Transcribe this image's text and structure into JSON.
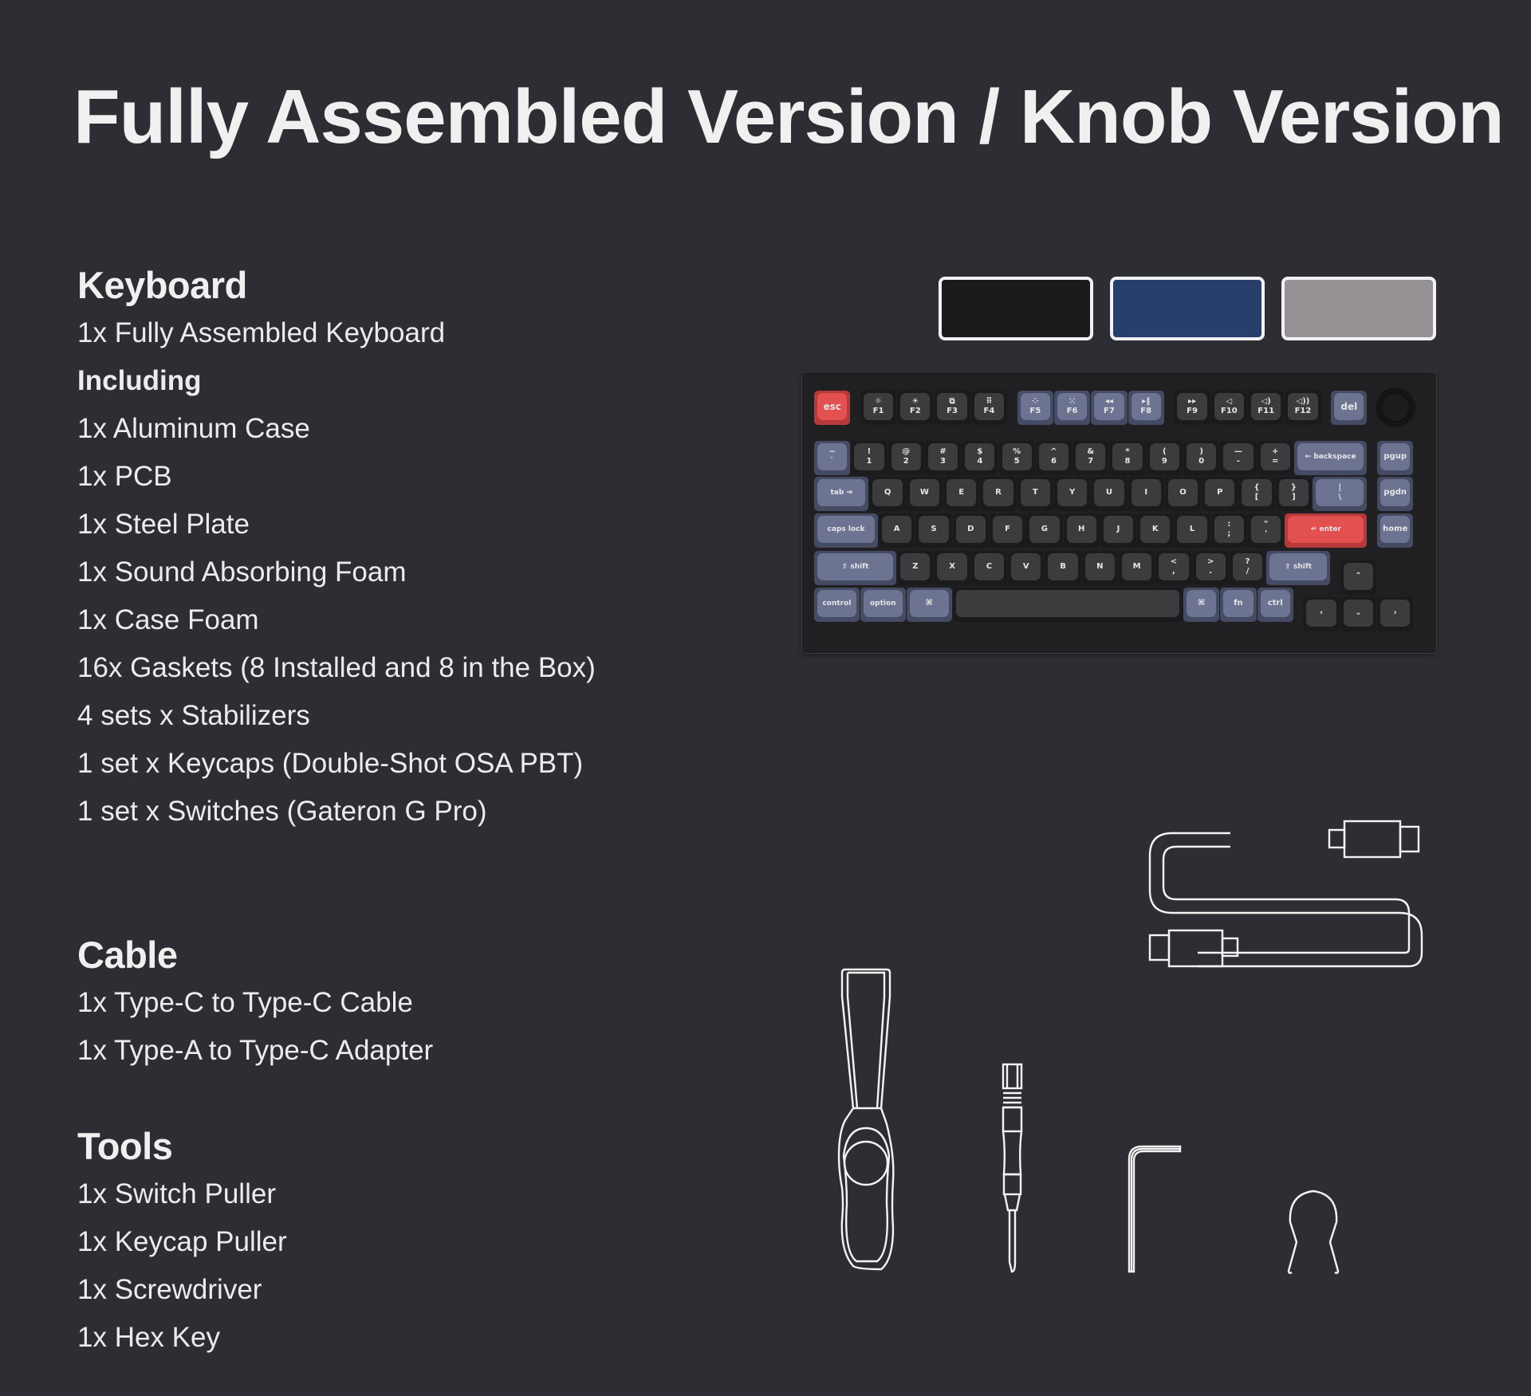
{
  "title": "Fully Assembled Version / Knob Version",
  "sections": {
    "keyboard": {
      "heading": "Keyboard",
      "items": [
        {
          "text": "1x Fully Assembled Keyboard",
          "bold": false
        },
        {
          "text": "Including",
          "bold": true
        },
        {
          "text": "1x Aluminum Case",
          "bold": false
        },
        {
          "text": "1x PCB",
          "bold": false
        },
        {
          "text": "1x Steel Plate",
          "bold": false
        },
        {
          "text": "1x Sound Absorbing Foam",
          "bold": false
        },
        {
          "text": "1x Case Foam",
          "bold": false
        },
        {
          "text": "16x Gaskets (8 Installed and 8 in the Box)",
          "bold": false
        },
        {
          "text": "4 sets x Stabilizers",
          "bold": false
        },
        {
          "text": "1 set x Keycaps (Double-Shot OSA PBT)",
          "bold": false
        },
        {
          "text": "1 set x Switches (Gateron G Pro)",
          "bold": false
        }
      ]
    },
    "cable": {
      "heading": "Cable",
      "items": [
        {
          "text": "1x Type-C to Type-C Cable",
          "bold": false
        },
        {
          "text": "1x Type-A to Type-C Adapter",
          "bold": false
        }
      ]
    },
    "tools": {
      "heading": "Tools",
      "items": [
        {
          "text": "1x Switch Puller",
          "bold": false
        },
        {
          "text": "1x Keycap Puller",
          "bold": false
        },
        {
          "text": "1x Screwdriver",
          "bold": false
        },
        {
          "text": "1x Hex Key",
          "bold": false
        }
      ]
    }
  },
  "color_options": [
    {
      "name": "black",
      "color": "#1b1b1b"
    },
    {
      "name": "navy-blue",
      "color": "#283e6c"
    },
    {
      "name": "silver-grey",
      "color": "#959194"
    }
  ],
  "keyboard": {
    "rows": [
      [
        {
          "top": "",
          "label": "esc",
          "style": "red",
          "w": 1
        },
        {
          "gap": 0.25
        },
        {
          "top": "☼",
          "label": "F1",
          "style": "dark",
          "w": 1
        },
        {
          "top": "☀",
          "label": "F2",
          "style": "dark",
          "w": 1
        },
        {
          "top": "⧉",
          "label": "F3",
          "style": "dark",
          "w": 1
        },
        {
          "top": "⠿",
          "label": "F4",
          "style": "dark",
          "w": 1
        },
        {
          "gap": 0.25
        },
        {
          "top": "⁘",
          "label": "F5",
          "style": "blue",
          "w": 1
        },
        {
          "top": "⁙",
          "label": "F6",
          "style": "blue",
          "w": 1
        },
        {
          "top": "◂◂",
          "label": "F7",
          "style": "blue",
          "w": 1
        },
        {
          "top": "▸‖",
          "label": "F8",
          "style": "blue",
          "w": 1
        },
        {
          "gap": 0.25
        },
        {
          "top": "▸▸",
          "label": "F9",
          "style": "dark",
          "w": 1
        },
        {
          "top": "◁",
          "label": "F10",
          "style": "dark",
          "w": 1
        },
        {
          "top": "◁)",
          "label": "F11",
          "style": "dark",
          "w": 1
        },
        {
          "top": "◁))",
          "label": "F12",
          "style": "dark",
          "w": 1
        },
        {
          "gap": 0.25
        },
        {
          "top": "",
          "label": "del",
          "style": "blue",
          "w": 1
        },
        {
          "gap": 0.25
        },
        {
          "knob": true,
          "w": 1
        }
      ],
      [
        {
          "top": "~",
          "label": "`",
          "style": "blue",
          "w": 1
        },
        {
          "top": "!",
          "label": "1",
          "style": "dark",
          "w": 1
        },
        {
          "top": "@",
          "label": "2",
          "style": "dark",
          "w": 1
        },
        {
          "top": "#",
          "label": "3",
          "style": "dark",
          "w": 1
        },
        {
          "top": "$",
          "label": "4",
          "style": "dark",
          "w": 1
        },
        {
          "top": "%",
          "label": "5",
          "style": "dark",
          "w": 1
        },
        {
          "top": "^",
          "label": "6",
          "style": "dark",
          "w": 1
        },
        {
          "top": "&",
          "label": "7",
          "style": "dark",
          "w": 1
        },
        {
          "top": "*",
          "label": "8",
          "style": "dark",
          "w": 1
        },
        {
          "top": "(",
          "label": "9",
          "style": "dark",
          "w": 1
        },
        {
          "top": ")",
          "label": "0",
          "style": "dark",
          "w": 1
        },
        {
          "top": "—",
          "label": "-",
          "style": "dark",
          "w": 1
        },
        {
          "top": "+",
          "label": "=",
          "style": "dark",
          "w": 1
        },
        {
          "top": "",
          "label": "← backspace",
          "style": "blue",
          "w": 2
        },
        {
          "gap": 0.25
        },
        {
          "top": "",
          "label": "pgup",
          "style": "blue",
          "w": 1
        }
      ],
      [
        {
          "top": "",
          "label": "tab ⇥",
          "style": "blue",
          "w": 1.5
        },
        {
          "top": "",
          "label": "Q",
          "style": "dark",
          "w": 1
        },
        {
          "top": "",
          "label": "W",
          "style": "dark",
          "w": 1
        },
        {
          "top": "",
          "label": "E",
          "style": "dark",
          "w": 1
        },
        {
          "top": "",
          "label": "R",
          "style": "dark",
          "w": 1
        },
        {
          "top": "",
          "label": "T",
          "style": "dark",
          "w": 1
        },
        {
          "top": "",
          "label": "Y",
          "style": "dark",
          "w": 1
        },
        {
          "top": "",
          "label": "U",
          "style": "dark",
          "w": 1
        },
        {
          "top": "",
          "label": "I",
          "style": "dark",
          "w": 1
        },
        {
          "top": "",
          "label": "O",
          "style": "dark",
          "w": 1
        },
        {
          "top": "",
          "label": "P",
          "style": "dark",
          "w": 1
        },
        {
          "top": "{",
          "label": "[",
          "style": "dark",
          "w": 1
        },
        {
          "top": "}",
          "label": "]",
          "style": "dark",
          "w": 1
        },
        {
          "top": "|",
          "label": "\\",
          "style": "blue",
          "w": 1.5
        },
        {
          "gap": 0.25
        },
        {
          "top": "",
          "label": "pgdn",
          "style": "blue",
          "w": 1
        }
      ],
      [
        {
          "top": "",
          "label": "caps lock",
          "style": "blue",
          "w": 1.75
        },
        {
          "top": "",
          "label": "A",
          "style": "dark",
          "w": 1
        },
        {
          "top": "",
          "label": "S",
          "style": "dark",
          "w": 1
        },
        {
          "top": "",
          "label": "D",
          "style": "dark",
          "w": 1
        },
        {
          "top": "",
          "label": "F",
          "style": "dark",
          "w": 1
        },
        {
          "top": "",
          "label": "G",
          "style": "dark",
          "w": 1
        },
        {
          "top": "",
          "label": "H",
          "style": "dark",
          "w": 1
        },
        {
          "top": "",
          "label": "J",
          "style": "dark",
          "w": 1
        },
        {
          "top": "",
          "label": "K",
          "style": "dark",
          "w": 1
        },
        {
          "top": "",
          "label": "L",
          "style": "dark",
          "w": 1
        },
        {
          "top": ":",
          "label": ";",
          "style": "dark",
          "w": 1
        },
        {
          "top": "\"",
          "label": "'",
          "style": "dark",
          "w": 1
        },
        {
          "top": "",
          "label": "↵ enter",
          "style": "red",
          "w": 2.25
        },
        {
          "gap": 0.25
        },
        {
          "top": "",
          "label": "home",
          "style": "blue",
          "w": 1
        }
      ],
      [
        {
          "top": "",
          "label": "⇧ shift",
          "style": "blue",
          "w": 2.25
        },
        {
          "top": "",
          "label": "Z",
          "style": "dark",
          "w": 1
        },
        {
          "top": "",
          "label": "X",
          "style": "dark",
          "w": 1
        },
        {
          "top": "",
          "label": "C",
          "style": "dark",
          "w": 1
        },
        {
          "top": "",
          "label": "V",
          "style": "dark",
          "w": 1
        },
        {
          "top": "",
          "label": "B",
          "style": "dark",
          "w": 1
        },
        {
          "top": "",
          "label": "N",
          "style": "dark",
          "w": 1
        },
        {
          "top": "",
          "label": "M",
          "style": "dark",
          "w": 1
        },
        {
          "top": "<",
          "label": ",",
          "style": "dark",
          "w": 1
        },
        {
          "top": ">",
          "label": ".",
          "style": "dark",
          "w": 1
        },
        {
          "top": "?",
          "label": "/",
          "style": "dark",
          "w": 1
        },
        {
          "top": "",
          "label": "⇧ shift",
          "style": "blue",
          "w": 1.75
        },
        {
          "gap": 0.25
        },
        {
          "top": "",
          "label": "⌃",
          "style": "dark",
          "w": 1,
          "dy": 0.25
        }
      ],
      [
        {
          "top": "",
          "label": "control",
          "style": "blue",
          "w": 1.25
        },
        {
          "top": "",
          "label": "option",
          "style": "blue",
          "w": 1.25
        },
        {
          "top": "",
          "label": "⌘",
          "style": "blue",
          "w": 1.25
        },
        {
          "top": "",
          "label": "",
          "style": "dark",
          "w": 6.25,
          "space": true
        },
        {
          "top": "",
          "label": "⌘",
          "style": "blue",
          "w": 1
        },
        {
          "top": "",
          "label": "fn",
          "style": "blue",
          "w": 1
        },
        {
          "top": "",
          "label": "ctrl",
          "style": "blue",
          "w": 1
        },
        {
          "gap": 0.25
        },
        {
          "top": "",
          "label": "‹",
          "style": "dark",
          "w": 1,
          "dy": 0.25
        },
        {
          "top": "",
          "label": "⌄",
          "style": "dark",
          "w": 1,
          "dy": 0.25
        },
        {
          "top": "",
          "label": "›",
          "style": "dark",
          "w": 1,
          "dy": 0.25
        }
      ]
    ]
  }
}
